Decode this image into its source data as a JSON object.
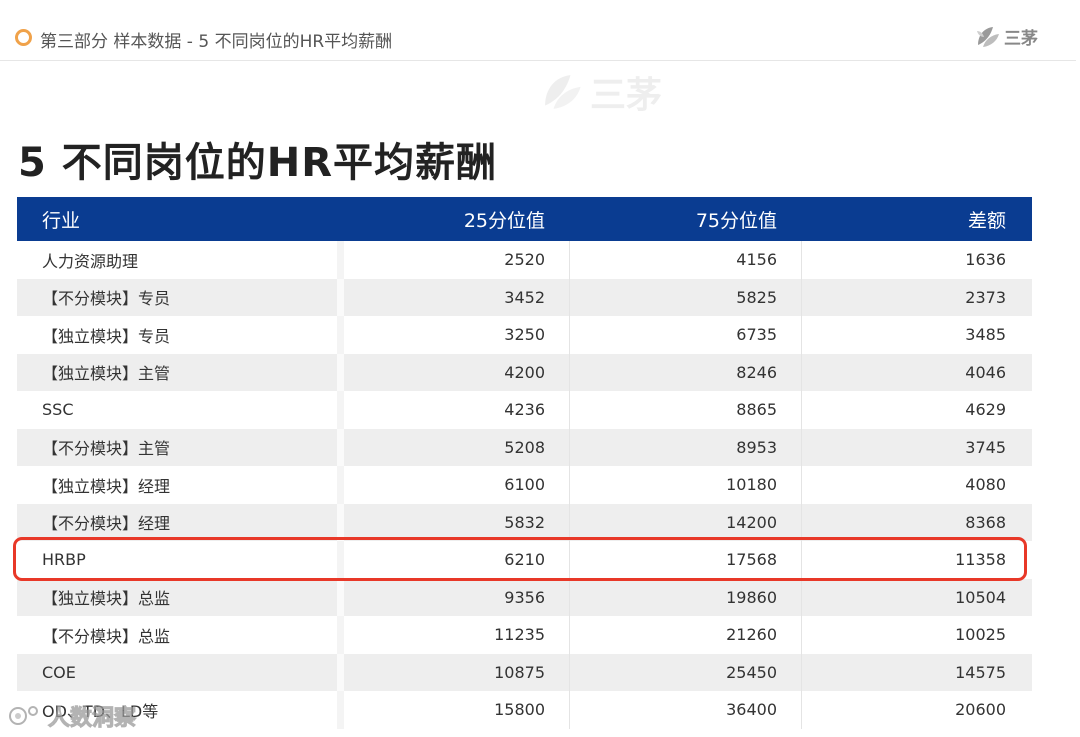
{
  "header": {
    "breadcrumb": "第三部分  样本数据  -  5  不同岗位的HR平均薪酬",
    "logo_text": "三茅"
  },
  "watermark": {
    "text": "三茅"
  },
  "title": "5 不同岗位的HR平均薪酬",
  "table": {
    "columns": [
      "行业",
      "25分位值",
      "75分位值",
      "差额"
    ],
    "rows": [
      [
        "人力资源助理",
        "2520",
        "4156",
        "1636"
      ],
      [
        "【不分模块】专员",
        "3452",
        "5825",
        "2373"
      ],
      [
        "【独立模块】专员",
        "3250",
        "6735",
        "3485"
      ],
      [
        "【独立模块】主管",
        "4200",
        "8246",
        "4046"
      ],
      [
        "SSC",
        "4236",
        "8865",
        "4629"
      ],
      [
        "【不分模块】主管",
        "5208",
        "8953",
        "3745"
      ],
      [
        "【独立模块】经理",
        "6100",
        "10180",
        "4080"
      ],
      [
        "【不分模块】经理",
        "5832",
        "14200",
        "8368"
      ],
      [
        "HRBP",
        "6210",
        "17568",
        "11358"
      ],
      [
        "【独立模块】总监",
        "9356",
        "19860",
        "10504"
      ],
      [
        "【不分模块】总监",
        "11235",
        "21260",
        "10025"
      ],
      [
        "COE",
        "10875",
        "25450",
        "14575"
      ],
      [
        "OD、TD、LD等",
        "15800",
        "36400",
        "20600"
      ]
    ],
    "highlighted_row": 8
  },
  "corner_watermark": {
    "text": "人数洞察"
  },
  "colors": {
    "header_bg": "#0a3c91",
    "highlight": "#e83828",
    "bullet": "#f0a24a",
    "zebra": "#eeeeee"
  },
  "icons": {
    "bullet": "ring-bullet-icon",
    "logo": "leaf-logo-icon",
    "corner": "camera-watermark-icon"
  }
}
